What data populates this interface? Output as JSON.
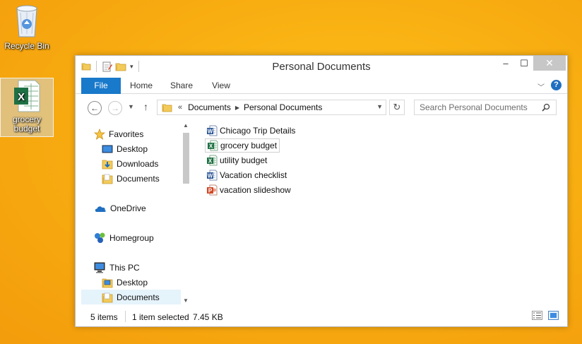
{
  "desktop": {
    "icons": [
      {
        "label": "Recycle Bin"
      },
      {
        "label": "grocery budget"
      }
    ]
  },
  "window": {
    "title": "Personal Documents",
    "controls": {
      "minimize": "–",
      "maximize": "☐",
      "close": "✕"
    }
  },
  "ribbon": {
    "tabs": [
      "File",
      "Home",
      "Share",
      "View"
    ]
  },
  "address": {
    "overflow": "«",
    "crumbs": [
      "Documents",
      "Personal Documents"
    ],
    "search_placeholder": "Search Personal Documents"
  },
  "nav_pane": {
    "items": [
      {
        "label": "Favorites",
        "icon": "star-icon"
      },
      {
        "label": "Desktop",
        "icon": "desktop-icon"
      },
      {
        "label": "Downloads",
        "icon": "downloads-icon"
      },
      {
        "label": "Documents",
        "icon": "folder-icon"
      },
      {
        "label": "OneDrive",
        "icon": "cloud-icon"
      },
      {
        "label": "Homegroup",
        "icon": "homegroup-icon"
      },
      {
        "label": "This PC",
        "icon": "computer-icon"
      },
      {
        "label": "Desktop",
        "icon": "folder-icon"
      },
      {
        "label": "Documents",
        "icon": "folder-icon",
        "selected": true
      }
    ]
  },
  "files": [
    {
      "name": "Chicago Trip Details",
      "type": "word"
    },
    {
      "name": "grocery budget",
      "type": "excel",
      "focused": true
    },
    {
      "name": "utility budget",
      "type": "excel"
    },
    {
      "name": "Vacation checklist",
      "type": "word"
    },
    {
      "name": "vacation slideshow",
      "type": "powerpoint"
    }
  ],
  "status": {
    "count": "5 items",
    "selection": "1 item selected",
    "size": "7.45 KB"
  },
  "colors": {
    "file_tab": "#1979ca",
    "word": "#2b5797",
    "excel": "#207245",
    "powerpoint": "#d24726",
    "folder": "#f3cb5b",
    "desktop_bg": "#f7ab10"
  }
}
